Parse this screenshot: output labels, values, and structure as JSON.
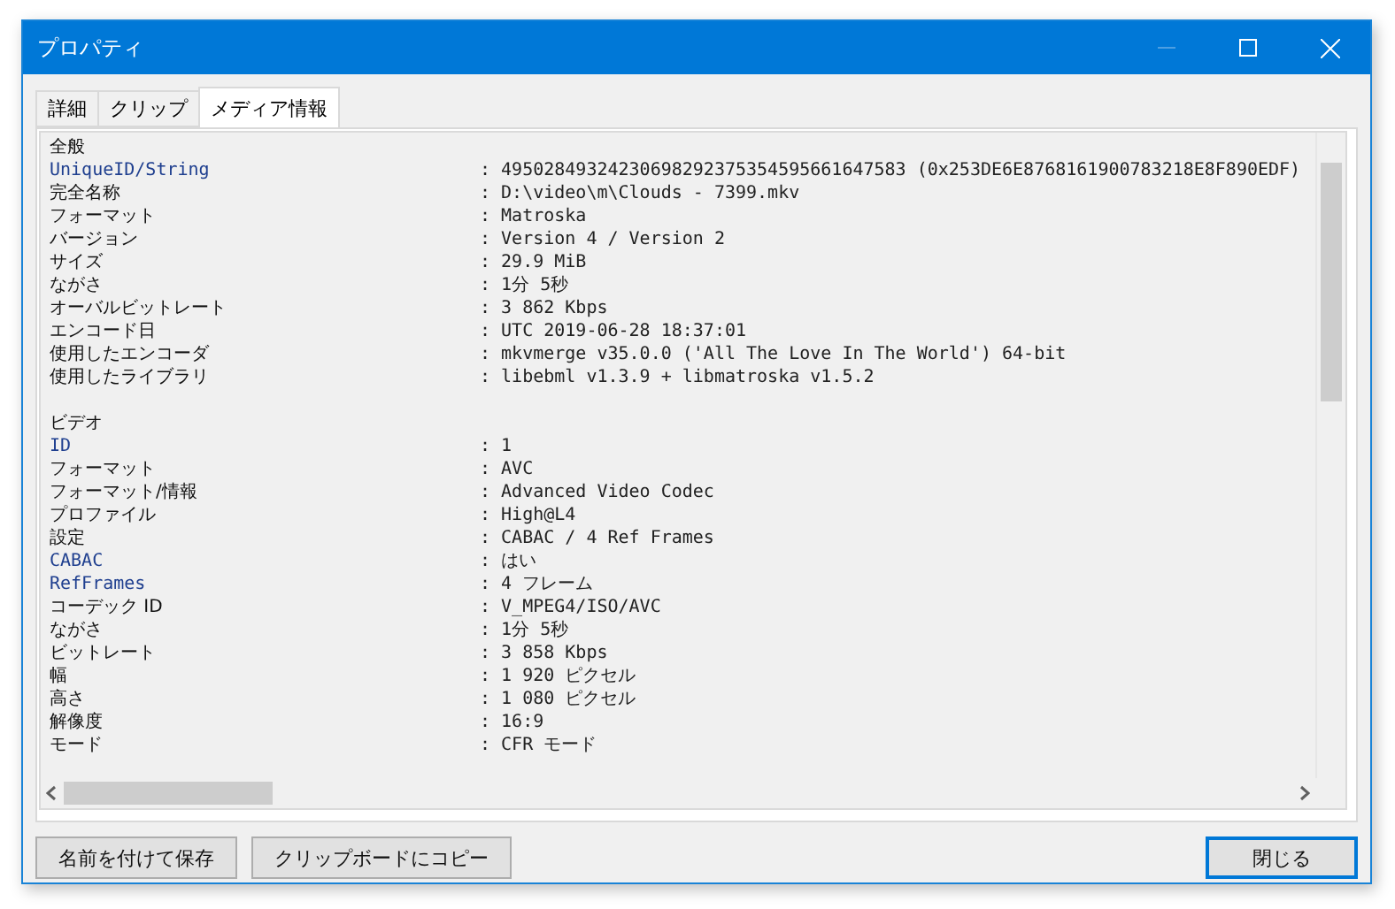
{
  "window": {
    "title": "プロパティ",
    "minimize_disabled": true
  },
  "tabs": [
    {
      "label": "詳細",
      "selected": false
    },
    {
      "label": "クリップ",
      "selected": false
    },
    {
      "label": "メディア情報",
      "selected": true
    }
  ],
  "rows": [
    {
      "kind": "section",
      "label": "全般"
    },
    {
      "kind": "tag",
      "label": "UniqueID/String",
      "value": ": 49502849324230698292375354595661647583 (0x253DE6E8768161900783218E8F890EDF)"
    },
    {
      "kind": "field",
      "label": "完全名称",
      "value": ": D:\\video\\m\\Clouds - 7399.mkv"
    },
    {
      "kind": "field",
      "label": "フォーマット",
      "value": ": Matroska"
    },
    {
      "kind": "field",
      "label": "バージョン",
      "value": ": Version 4 / Version 2"
    },
    {
      "kind": "field",
      "label": "サイズ",
      "value": ": 29.9 MiB"
    },
    {
      "kind": "field",
      "label": "ながさ",
      "value": ": 1分 5秒"
    },
    {
      "kind": "field",
      "label": "オーバルビットレート",
      "value": ": 3 862 Kbps"
    },
    {
      "kind": "field",
      "label": "エンコード日",
      "value": ": UTC 2019-06-28 18:37:01"
    },
    {
      "kind": "field",
      "label": "使用したエンコーダ",
      "value": ": mkvmerge v35.0.0 ('All The Love In The World') 64-bit"
    },
    {
      "kind": "field",
      "label": "使用したライブラリ",
      "value": ": libebml v1.3.9 + libmatroska v1.5.2"
    },
    {
      "kind": "blank"
    },
    {
      "kind": "section",
      "label": "ビデオ"
    },
    {
      "kind": "tag",
      "label": "ID",
      "value": ": 1"
    },
    {
      "kind": "field",
      "label": "フォーマット",
      "value": ": AVC"
    },
    {
      "kind": "field",
      "label": "フォーマット/情報",
      "value": ": Advanced Video Codec"
    },
    {
      "kind": "field",
      "label": "プロファイル",
      "value": ": High@L4"
    },
    {
      "kind": "field",
      "label": "設定",
      "value": ": CABAC / 4 Ref Frames"
    },
    {
      "kind": "tag",
      "label": "CABAC",
      "value": ": はい"
    },
    {
      "kind": "tag",
      "label": "RefFrames",
      "value": ": 4 フレーム"
    },
    {
      "kind": "field",
      "label": "コーデック ID",
      "value": ": V_MPEG4/ISO/AVC"
    },
    {
      "kind": "field",
      "label": "ながさ",
      "value": ": 1分 5秒"
    },
    {
      "kind": "field",
      "label": "ビットレート",
      "value": ": 3 858 Kbps"
    },
    {
      "kind": "field",
      "label": "幅",
      "value": ": 1 920 ピクセル"
    },
    {
      "kind": "field",
      "label": "高さ",
      "value": ": 1 080 ピクセル"
    },
    {
      "kind": "field",
      "label": "解像度",
      "value": ": 16:9"
    },
    {
      "kind": "field",
      "label": "モード",
      "value": ": CFR モード"
    }
  ],
  "buttons": [
    {
      "label": "名前を付けて保存",
      "default": false
    },
    {
      "label": "クリップボードにコピー",
      "default": false
    }
  ],
  "close_button": {
    "label": "閉じる",
    "default": true
  }
}
